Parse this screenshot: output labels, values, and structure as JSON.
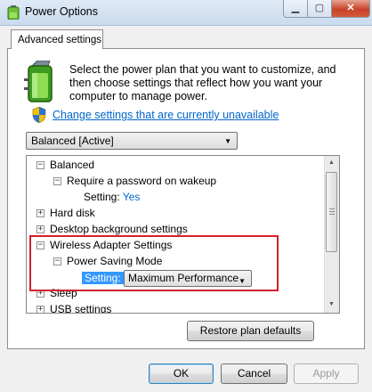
{
  "window": {
    "title": "Power Options",
    "close_glyph": "✕"
  },
  "tab": {
    "label": "Advanced settings"
  },
  "intro": {
    "text": "Select the power plan that you want to customize, and then choose settings that reflect how you want your computer to manage power."
  },
  "change_link": {
    "label": "Change settings that are currently unavailable"
  },
  "plan_select": {
    "value": "Balanced [Active]"
  },
  "tree": {
    "balanced": {
      "label": "Balanced",
      "expander": "−"
    },
    "password_wakeup": {
      "label": "Require a password on wakeup",
      "expander": "−"
    },
    "password_setting": {
      "label": "Setting:",
      "value": "Yes"
    },
    "hard_disk": {
      "label": "Hard disk",
      "expander": "+"
    },
    "desktop_background": {
      "label": "Desktop background settings",
      "expander": "+"
    },
    "wireless_adapter": {
      "label": "Wireless Adapter Settings",
      "expander": "−"
    },
    "power_saving_mode": {
      "label": "Power Saving Mode",
      "expander": "−"
    },
    "power_saving_setting": {
      "label": "Setting:",
      "value": "Maximum Performance"
    },
    "sleep": {
      "label": "Sleep",
      "expander": "+"
    },
    "usb_settings": {
      "label": "USB settings",
      "expander": "+"
    }
  },
  "buttons": {
    "restore": "Restore plan defaults",
    "ok": "OK",
    "cancel": "Cancel",
    "apply": "Apply"
  },
  "colors": {
    "link": "#0066cc",
    "highlight": "#d3212c",
    "selection": "#3399ff"
  }
}
